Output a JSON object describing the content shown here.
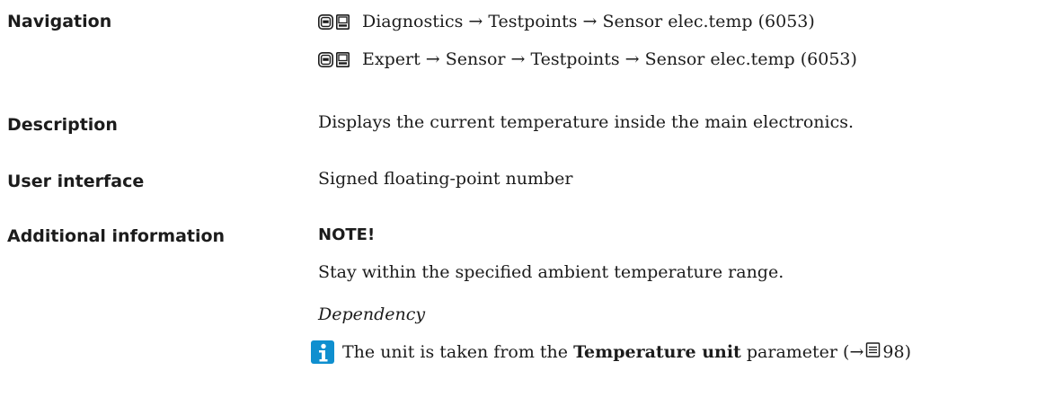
{
  "navigation": {
    "label": "Navigation",
    "paths": [
      {
        "icons": [
          "display-icon",
          "operating-icon"
        ],
        "text": "Diagnostics → Testpoints → Sensor elec.temp (6053)"
      },
      {
        "icons": [
          "display-icon",
          "operating-icon"
        ],
        "text": "Expert → Sensor → Testpoints → Sensor elec.temp (6053)"
      }
    ]
  },
  "description": {
    "label": "Description",
    "text": "Displays the current temperature inside the main electronics."
  },
  "user_interface": {
    "label": "User interface",
    "text": "Signed floating-point number"
  },
  "additional_information": {
    "label": "Additional information",
    "note_title": "NOTE!",
    "note_text": "Stay within the specified ambient temperature range.",
    "dependency_title": "Dependency",
    "info_prefix": "The unit is taken from the",
    "info_param": "Temperature unit",
    "info_suffix": "parameter (→",
    "info_page": "98)"
  },
  "colors": {
    "info_icon": "#0f8fcf",
    "text": "#1c1c1c"
  }
}
